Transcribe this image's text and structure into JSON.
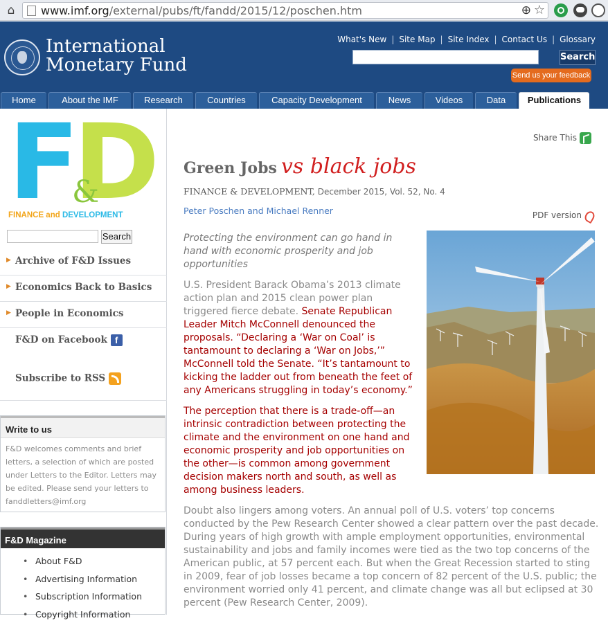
{
  "browser": {
    "url_host": "www.imf.org",
    "url_path": "/external/pubs/ft/fandd/2015/12/poschen.htm",
    "icons": [
      "home-icon",
      "page-icon",
      "zoom-icon",
      "star-icon"
    ]
  },
  "header": {
    "org_line1": "International",
    "org_line2": "Monetary Fund",
    "top_links": [
      "What's New",
      "Site Map",
      "Site Index",
      "Contact Us",
      "Glossary"
    ],
    "search_placeholder": "",
    "search_button": "Search",
    "feedback_button": "Send us your feedback"
  },
  "nav": {
    "tabs": [
      {
        "label": "Home"
      },
      {
        "label": "About the IMF"
      },
      {
        "label": "Research"
      },
      {
        "label": "Countries"
      },
      {
        "label": "Capacity Development"
      },
      {
        "label": "News"
      },
      {
        "label": "Videos"
      },
      {
        "label": "Data"
      },
      {
        "label": "Publications",
        "active": true
      }
    ]
  },
  "sidebar": {
    "logo_f": "F",
    "logo_amp": "&",
    "logo_d": "D",
    "logo_tag_a": "FINANCE and",
    "logo_tag_b": "DEVELOPMENT",
    "search_button": "Search",
    "links": [
      "Archive of F&D Issues",
      "Economics Back to Basics",
      "People in Economics",
      "F&D on Facebook",
      "Subscribe to RSS"
    ],
    "write_title": "Write to us",
    "write_body": "F&D welcomes comments and brief letters, a selection of which are posted under Letters to the Editor. Letters may be edited. Please send your letters to fanddletters@imf.org",
    "magazine_title": "F&D Magazine",
    "magazine_items": [
      "About F&D",
      "Advertising Information",
      "Subscription Information",
      "Copyright Information"
    ]
  },
  "article": {
    "share": "Share This",
    "title_a": "Green Jobs",
    "title_b": "vs black jobs",
    "publication": "FINANCE & DEVELOPMENT,",
    "issue": "December 2015, Vol. 52, No. 4",
    "authors": "Peter Poschen and Michael Renner",
    "pdf": "PDF version",
    "deck": "Protecting the environment can go hand in hand with economic prosperity and job opportunities",
    "p1_grey": "U.S. President Barack Obama’s 2013 climate action plan and 2015 clean power plan triggered fierce debate.",
    "p1_red": "Senate Republican Leader Mitch McConnell denounced the proposals. “Declaring a ‘War on Coal’ is tantamount to declaring a ‘War on Jobs,’” McConnell told the Senate. “It’s tantamount to kicking the ladder out from beneath the feet of any Americans struggling in today’s economy.”",
    "p2": "The perception that there is a trade-off—an intrinsic contradiction between protecting the climate and the environment on one hand and economic prosperity and job opportunities on the other—is common among government decision makers north and south, as well as among business leaders.",
    "p3": "Doubt also lingers among voters. An annual poll of U.S. voters’ top concerns conducted by the Pew Research Center showed a clear pattern over the past decade. During years of high growth with ample employment opportunities, environmental sustainability and jobs and family incomes were tied as the two top concerns of the American public, at 57 percent each. But when the Great Recession started to sting in 2009, fear of job losses became a top concern of 82 percent of the U.S. public; the environment worried only 41 percent, and climate change was all but eclipsed at 30 percent (Pew Research Center, 2009).",
    "photo": "wind-turbine-photo"
  }
}
